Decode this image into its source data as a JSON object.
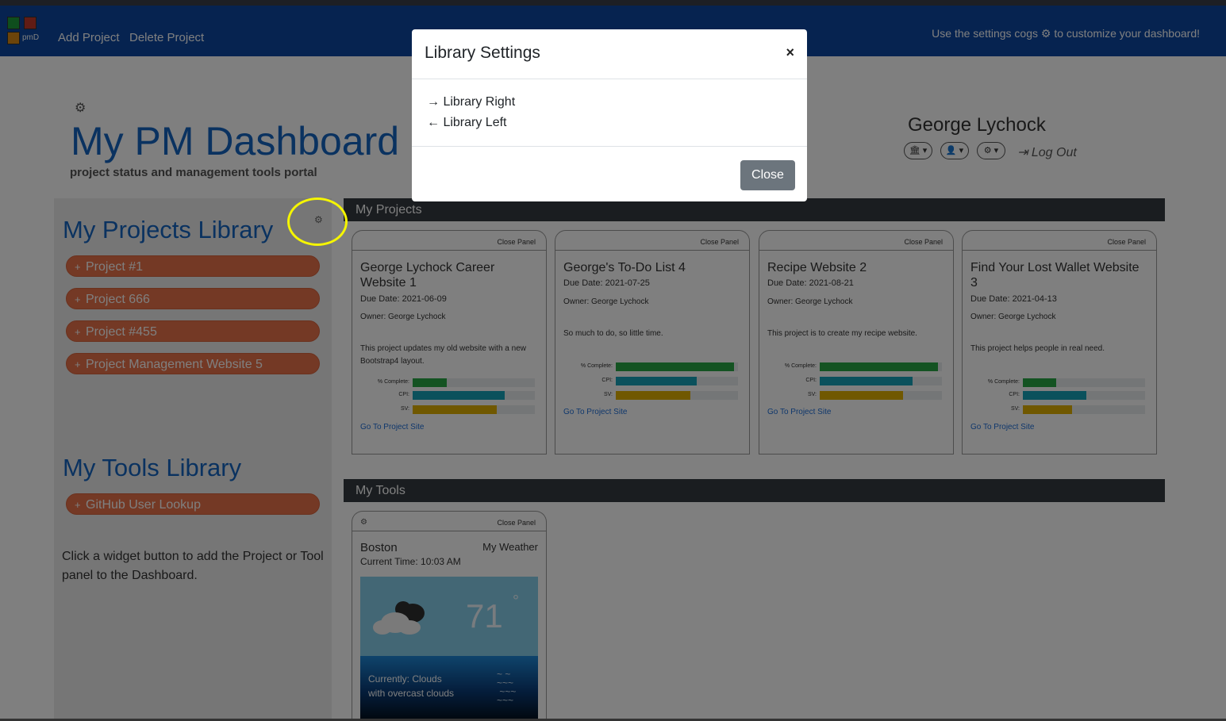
{
  "navbar": {
    "logo_text": "pmD",
    "add_project": "Add Project",
    "delete_project": "Delete Project",
    "hint": "Use the settings cogs ⚙ to customize your dashboard!"
  },
  "header": {
    "title": "My PM Dashboard",
    "subtitle": "project status and management tools portal",
    "username": "George Lychock",
    "logout": "Log Out",
    "user_buttons": [
      "🏛 ▾",
      "👤 ▾",
      "⚙ ▾"
    ]
  },
  "sidebar": {
    "projects_title": "My Projects Library",
    "projects": [
      "Project #1",
      "Project 666",
      "Project #455",
      "Project Management Website 5"
    ],
    "tools_title": "My Tools Library",
    "tools": [
      "GitHub User Lookup"
    ],
    "note": "Click a widget button to add the Project or Tool panel to the Dashboard."
  },
  "projects_section": {
    "title": "My Projects",
    "cards": [
      {
        "close": "Close Panel",
        "title": "George Lychock Career Website 1",
        "due": "Due Date: 2021-06-09",
        "owner": "Owner: George Lychock",
        "desc": "This project updates my old website with a new Bootstrap4 layout.",
        "complete": 0.28,
        "cpi": 0.75,
        "sv": 0.69,
        "link": "Go To Project Site"
      },
      {
        "close": "Close Panel",
        "title": "George's To-Do List 4",
        "due": "Due Date: 2021-07-25",
        "owner": "Owner: George Lychock",
        "desc": "So much to do, so little time.",
        "complete": 0.97,
        "cpi": 0.66,
        "sv": 0.61,
        "link": "Go To Project Site"
      },
      {
        "close": "Close Panel",
        "title": "Recipe Website 2",
        "due": "Due Date: 2021-08-21",
        "owner": "Owner: George Lychock",
        "desc": "This project is to create my recipe website.",
        "complete": 0.97,
        "cpi": 0.76,
        "sv": 0.68,
        "link": "Go To Project Site"
      },
      {
        "close": "Close Panel",
        "title": "Find Your Lost Wallet Website 3",
        "due": "Due Date: 2021-04-13",
        "owner": "Owner: George Lychock",
        "desc": "This project helps people in real need.",
        "complete": 0.27,
        "cpi": 0.52,
        "sv": 0.4,
        "link": "Go To Project Site"
      }
    ],
    "bar_labels": {
      "complete": "% Complete:",
      "cpi": "CPI:",
      "sv": "SV:"
    },
    "bar_colors": {
      "complete": "#28a745",
      "cpi": "#17a2b8",
      "sv": "#e0b100"
    }
  },
  "tools_section": {
    "title": "My Tools",
    "weather": {
      "close": "Close Panel",
      "city": "Boston",
      "tag": "My Weather",
      "time": "Current Time: 10:03 AM",
      "temp": "71",
      "deg": "°",
      "desc_line1": "Currently: Clouds",
      "desc_line2": "with overcast clouds"
    }
  },
  "modal": {
    "title": "Library Settings",
    "x": "×",
    "option_right": "→ Library Right",
    "option_left": "← Library Left",
    "close": "Close"
  }
}
